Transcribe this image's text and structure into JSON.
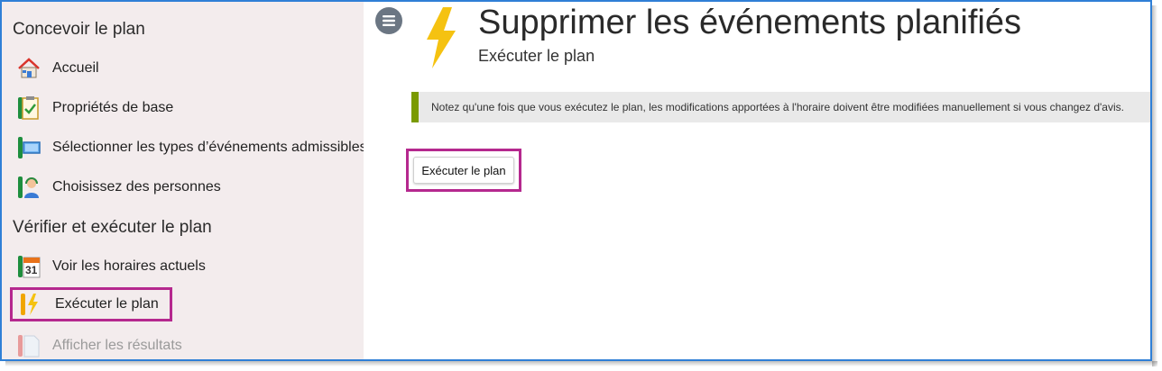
{
  "sidebar": {
    "section1_title": "Concevoir le plan",
    "section2_title": "Vérifier et exécuter le plan",
    "items": [
      {
        "label": "Accueil",
        "icon": "home-icon"
      },
      {
        "label": "Propriétés de base",
        "icon": "clipboard-check-icon"
      },
      {
        "label": "Sélectionner les types d’événements admissibles",
        "icon": "screen-icon"
      },
      {
        "label": "Choisissez des personnes",
        "icon": "person-headset-icon"
      },
      {
        "label": "Voir les horaires actuels",
        "icon": "calendar-icon",
        "calendar_day": "31"
      },
      {
        "label": "Exécuter le plan",
        "icon": "lightning-icon",
        "active": true
      },
      {
        "label": "Afficher les résultats",
        "icon": "document-icon",
        "disabled": true
      }
    ]
  },
  "main": {
    "title": "Supprimer les événements planifiés",
    "subtitle": "Exécuter le plan",
    "notice": "Notez qu'une fois que vous exécutez le plan, les modifications apportées à l'horaire doivent être modifiées manuellement si vous changez d'avis.",
    "run_button_label": "Exécuter le plan"
  },
  "colors": {
    "accent_highlight": "#b5288e",
    "notice_bar": "#7a9a01",
    "bolt": "#f5c211",
    "sidebar_bg": "#f3eced",
    "frame_border": "#2f7fd6"
  }
}
